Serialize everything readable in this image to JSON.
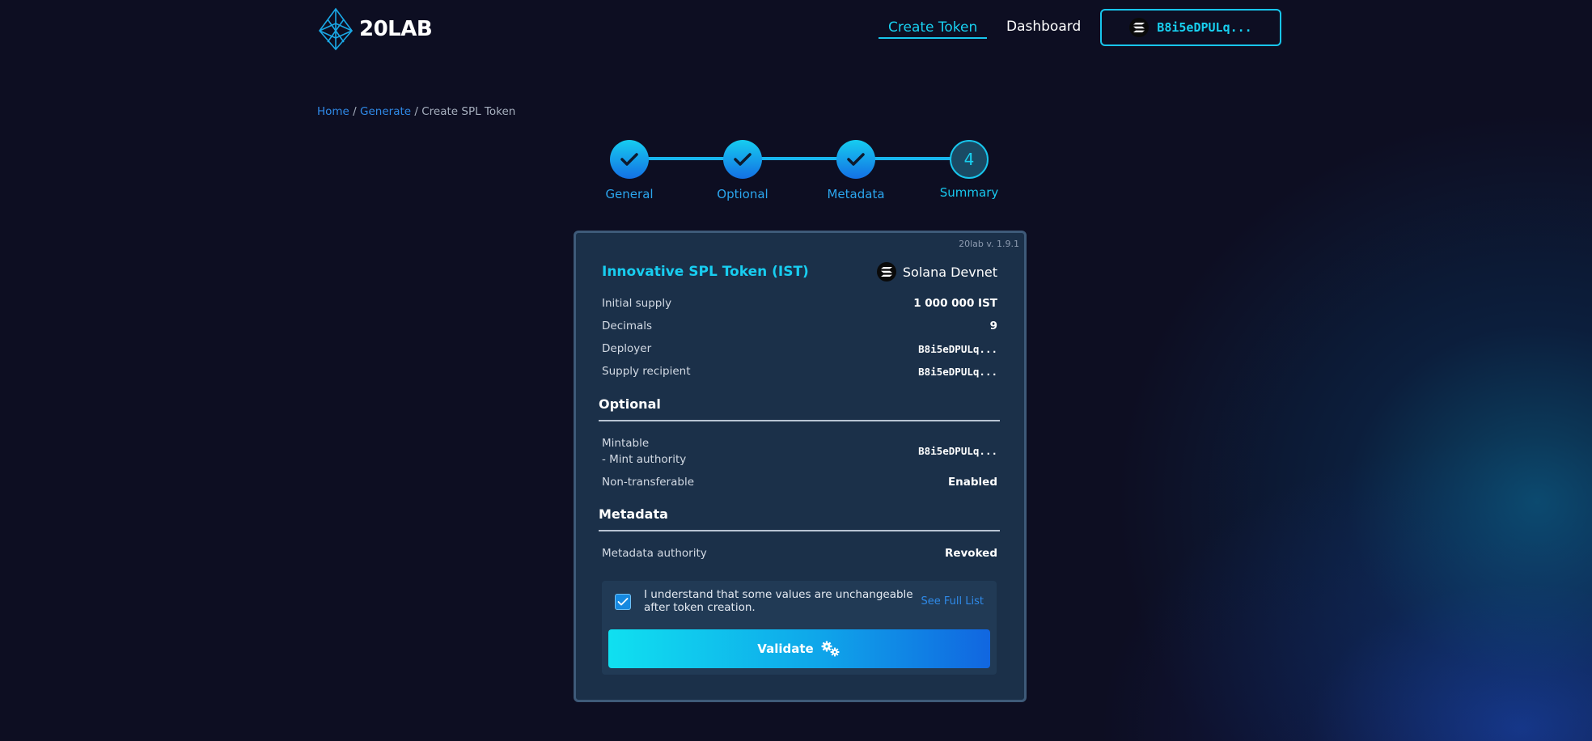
{
  "header": {
    "logo_text": "20LAB",
    "nav": [
      {
        "label": "Create Token",
        "active": true
      },
      {
        "label": "Dashboard",
        "active": false
      }
    ],
    "wallet_label": "B8i5eDPULq..."
  },
  "breadcrumb": {
    "items": [
      "Home",
      "Generate"
    ],
    "separator": "/",
    "current": "Create SPL Token"
  },
  "stepper": {
    "steps": [
      {
        "label": "General",
        "status": "done"
      },
      {
        "label": "Optional",
        "status": "done"
      },
      {
        "label": "Metadata",
        "status": "done"
      },
      {
        "label": "Summary",
        "status": "current",
        "number": "4"
      }
    ]
  },
  "summary": {
    "version": "20lab v. 1.9.1",
    "token_name": "Innovative SPL Token (IST)",
    "network": "Solana Devnet",
    "general_rows": [
      {
        "label": "Initial supply",
        "value": "1 000 000 IST"
      },
      {
        "label": "Decimals",
        "value": "9"
      },
      {
        "label": "Deployer",
        "value": "B8i5eDPULq..."
      },
      {
        "label": "Supply recipient",
        "value": "B8i5eDPULq..."
      }
    ],
    "optional": {
      "title": "Optional",
      "mintable_label": "Mintable",
      "mint_authority_label": "- Mint authority",
      "mint_authority_value": "B8i5eDPULq...",
      "non_transferable_label": "Non-transferable",
      "non_transferable_value": "Enabled"
    },
    "metadata": {
      "title": "Metadata",
      "authority_label": "Metadata authority",
      "authority_value": "Revoked"
    },
    "confirm": {
      "checked": true,
      "text": "I understand that some values are unchangeable after token creation.",
      "see_full_list": "See Full List"
    },
    "validate_label": "Validate"
  },
  "colors": {
    "background": "#0d0e22",
    "accent": "#18c5ec",
    "card": "#1b3049",
    "link": "#2f8ae8"
  }
}
